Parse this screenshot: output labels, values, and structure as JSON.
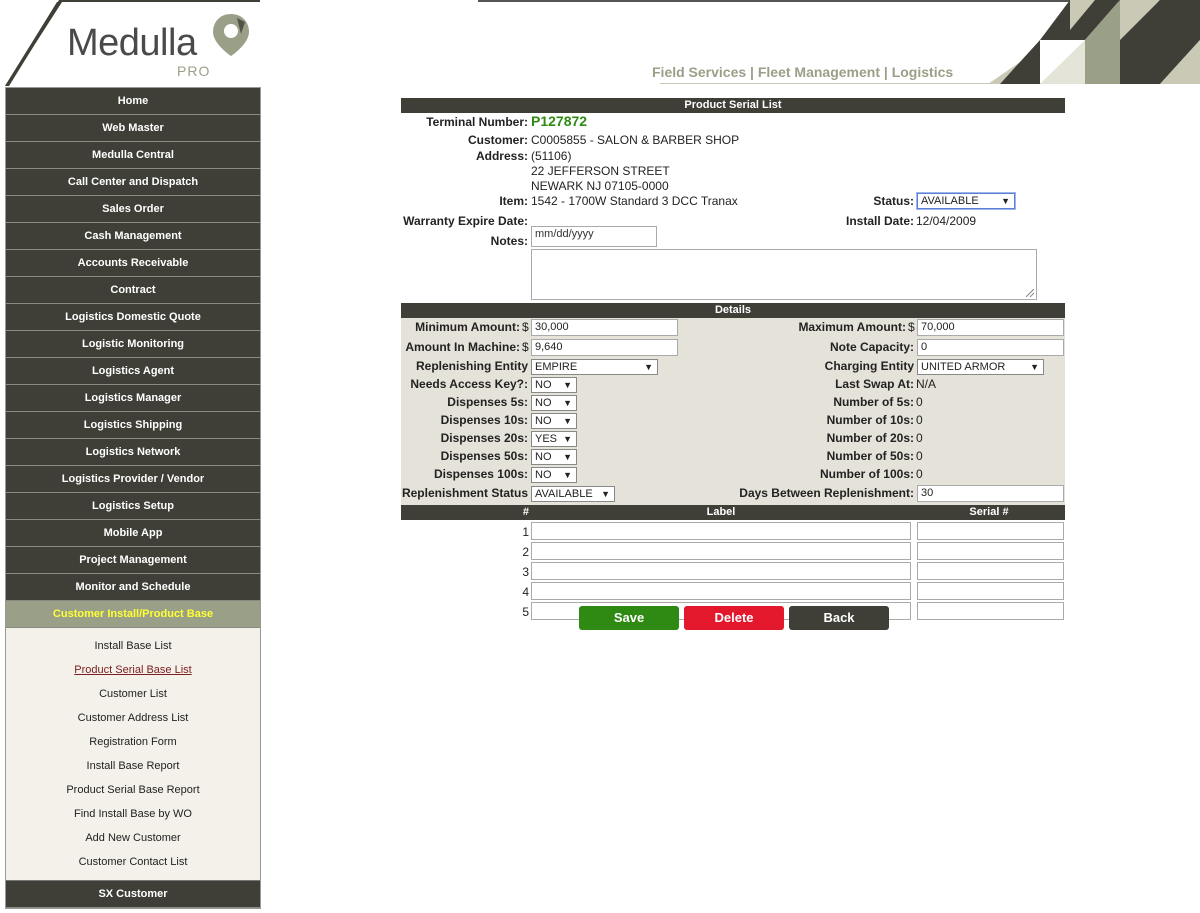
{
  "header": {
    "logo_text": "Medulla",
    "logo_sub": "PRO",
    "tagline": "Field Services | Fleet Management | Logistics"
  },
  "sidebar": {
    "items": [
      {
        "label": "Home"
      },
      {
        "label": "Web Master"
      },
      {
        "label": "Medulla Central"
      },
      {
        "label": "Call Center and Dispatch"
      },
      {
        "label": "Sales Order"
      },
      {
        "label": "Cash Management"
      },
      {
        "label": "Accounts Receivable"
      },
      {
        "label": "Contract"
      },
      {
        "label": "Logistics Domestic Quote"
      },
      {
        "label": "Logistic Monitoring"
      },
      {
        "label": "Logistics Agent"
      },
      {
        "label": "Logistics Manager"
      },
      {
        "label": "Logistics Shipping"
      },
      {
        "label": "Logistics Network"
      },
      {
        "label": "Logistics Provider / Vendor"
      },
      {
        "label": "Logistics Setup"
      },
      {
        "label": "Mobile App"
      },
      {
        "label": "Project Management"
      },
      {
        "label": "Monitor and Schedule"
      },
      {
        "label": "Customer Install/Product Base"
      }
    ],
    "submenu": [
      {
        "label": "Install Base List"
      },
      {
        "label": "Product Serial Base List"
      },
      {
        "label": "Customer List"
      },
      {
        "label": "Customer Address List"
      },
      {
        "label": "Registration Form"
      },
      {
        "label": "Install Base Report"
      },
      {
        "label": "Product Serial Base Report"
      },
      {
        "label": "Find Install Base by WO"
      },
      {
        "label": "Add New Customer"
      },
      {
        "label": "Customer Contact List"
      }
    ],
    "bottom_item": "SX Customer"
  },
  "form": {
    "title": "Product Serial List",
    "terminal_label": "Terminal Number:",
    "terminal_value": "P127872",
    "customer_label": "Customer:",
    "customer_value": "C0005855 - SALON & BARBER SHOP",
    "address_label": "Address:",
    "address_line1": "(51106)",
    "address_line2": "22 JEFFERSON STREET",
    "address_line3": "NEWARK NJ 07105-0000",
    "item_label": "Item:",
    "item_value": "1542 - 1700W Standard 3 DCC Tranax",
    "status_label": "Status:",
    "status_value": "AVAILABLE",
    "warranty_label": "Warranty Expire Date:",
    "warranty_placeholder": "mm/dd/yyyy",
    "install_label": "Install Date:",
    "install_value": "12/04/2009",
    "notes_label": "Notes:"
  },
  "details": {
    "title": "Details",
    "min_amount_label": "Minimum Amount:",
    "min_amount_value": "30,000",
    "max_amount_label": "Maximum Amount:",
    "max_amount_value": "70,000",
    "amount_machine_label": "Amount In Machine:",
    "amount_machine_value": "9,640",
    "note_capacity_label": "Note Capacity:",
    "note_capacity_value": "0",
    "replenishing_label": "Replenishing Entity",
    "replenishing_value": "EMPIRE",
    "charging_label": "Charging Entity",
    "charging_value": "UNITED ARMOR",
    "access_key_label": "Needs Access Key?:",
    "access_key_value": "NO",
    "last_swap_label": "Last Swap At:",
    "last_swap_value": "N/A",
    "dispenses_5_label": "Dispenses 5s:",
    "dispenses_5_value": "NO",
    "number_5_label": "Number of 5s:",
    "number_5_value": "0",
    "dispenses_10_label": "Dispenses 10s:",
    "dispenses_10_value": "NO",
    "number_10_label": "Number of 10s:",
    "number_10_value": "0",
    "dispenses_20_label": "Dispenses 20s:",
    "dispenses_20_value": "YES",
    "number_20_label": "Number of 20s:",
    "number_20_value": "0",
    "dispenses_50_label": "Dispenses 50s:",
    "dispenses_50_value": "NO",
    "number_50_label": "Number of 50s:",
    "number_50_value": "0",
    "dispenses_100_label": "Dispenses 100s:",
    "dispenses_100_value": "NO",
    "number_100_label": "Number of 100s:",
    "number_100_value": "0",
    "replenishment_status_label": "Replenishment Status",
    "replenishment_status_value": "AVAILABLE",
    "days_between_label": "Days Between Replenishment:",
    "days_between_value": "30"
  },
  "serials": {
    "col_num": "#",
    "col_label": "Label",
    "col_serial": "Serial #",
    "rows": [
      "1",
      "2",
      "3",
      "4",
      "5"
    ]
  },
  "buttons": {
    "save": "Save",
    "delete": "Delete",
    "back": "Back"
  },
  "colors": {
    "nav_bg": "#3f3f38",
    "accent": "#9aa088",
    "active_text": "#ffff33",
    "terminal_green": "#2e8a13"
  }
}
